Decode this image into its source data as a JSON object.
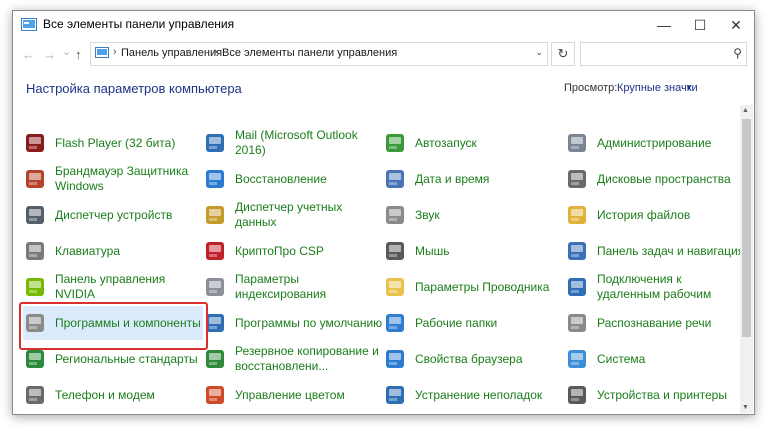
{
  "window": {
    "title": "Все элементы панели управления"
  },
  "titlebar_buttons": {
    "minimize": "—",
    "maximize": "☐",
    "close": "✕"
  },
  "nav": {
    "back": "←",
    "forward": "→",
    "recent": "⌄",
    "up": "↑",
    "refresh": "↻",
    "search_icon": "⚲"
  },
  "breadcrumb": [
    "Панель управления",
    "Все элементы панели управления"
  ],
  "page": {
    "heading": "Настройка параметров компьютера",
    "view_label": "Просмотр:",
    "view_value": "Крупные значки"
  },
  "items": [
    {
      "label": "Flash Player (32 бита)",
      "icon": "flash-player-icon",
      "color": "#8b1c1c"
    },
    {
      "label": "Mail (Microsoft Outlook 2016)",
      "icon": "mail-icon",
      "color": "#2f6db5"
    },
    {
      "label": "Автозапуск",
      "icon": "autoplay-icon",
      "color": "#3a9a3a"
    },
    {
      "label": "Администрирование",
      "icon": "administrative-tools-icon",
      "color": "#7a8593"
    },
    {
      "label": "Брандмауэр Защитника Windows",
      "icon": "firewall-icon",
      "color": "#b4442a"
    },
    {
      "label": "Восстановление",
      "icon": "recovery-icon",
      "color": "#2b7bd0"
    },
    {
      "label": "Дата и время",
      "icon": "date-time-icon",
      "color": "#4a74b8"
    },
    {
      "label": "Дисковые пространства",
      "icon": "storage-spaces-icon",
      "color": "#6a6a6a"
    },
    {
      "label": "Диспетчер устройств",
      "icon": "device-manager-icon",
      "color": "#555f6b"
    },
    {
      "label": "Диспетчер учетных данных",
      "icon": "credential-manager-icon",
      "color": "#c49a2a"
    },
    {
      "label": "Звук",
      "icon": "sound-icon",
      "color": "#8a8a8a"
    },
    {
      "label": "История файлов",
      "icon": "file-history-icon",
      "color": "#e0b23a"
    },
    {
      "label": "Клавиатура",
      "icon": "keyboard-icon",
      "color": "#7a7a7a"
    },
    {
      "label": "КриптоПро CSP",
      "icon": "cryptopro-icon",
      "color": "#c0202a"
    },
    {
      "label": "Мышь",
      "icon": "mouse-icon",
      "color": "#5a5a5a"
    },
    {
      "label": "Панель задач и навигация",
      "icon": "taskbar-icon",
      "color": "#3b6fb6"
    },
    {
      "label": "Панель управления NVIDIA",
      "icon": "nvidia-icon",
      "color": "#76b900"
    },
    {
      "label": "Параметры индексирования",
      "icon": "indexing-options-icon",
      "color": "#8a8f99"
    },
    {
      "label": "Параметры Проводника",
      "icon": "file-explorer-options-icon",
      "color": "#e8c24a"
    },
    {
      "label": "Подключения к удаленным рабочим",
      "icon": "remote-desktop-icon",
      "color": "#2f6db5"
    },
    {
      "label": "Программы и компоненты",
      "icon": "programs-features-icon",
      "color": "#8a8a8a"
    },
    {
      "label": "Программы по умолчанию",
      "icon": "default-programs-icon",
      "color": "#2f6db5"
    },
    {
      "label": "Рабочие папки",
      "icon": "work-folders-icon",
      "color": "#2f7fd0"
    },
    {
      "label": "Распознавание речи",
      "icon": "speech-recognition-icon",
      "color": "#8a8a8a"
    },
    {
      "label": "Региональные стандарты",
      "icon": "region-icon",
      "color": "#2b8a3e"
    },
    {
      "label": "Резервное копирование и восстановлени...",
      "icon": "backup-restore-icon",
      "color": "#2f8a3a"
    },
    {
      "label": "Свойства браузера",
      "icon": "internet-options-icon",
      "color": "#2b7bd0"
    },
    {
      "label": "Система",
      "icon": "system-icon",
      "color": "#3b8fd8"
    },
    {
      "label": "Телефон и модем",
      "icon": "phone-modem-icon",
      "color": "#6a6a6a"
    },
    {
      "label": "Управление цветом",
      "icon": "color-management-icon",
      "color": "#d04a2a"
    },
    {
      "label": "Устранение неполадок",
      "icon": "troubleshooting-icon",
      "color": "#2f6db5"
    },
    {
      "label": "Устройства и принтеры",
      "icon": "devices-printers-icon",
      "color": "#5a5a5a"
    }
  ]
}
